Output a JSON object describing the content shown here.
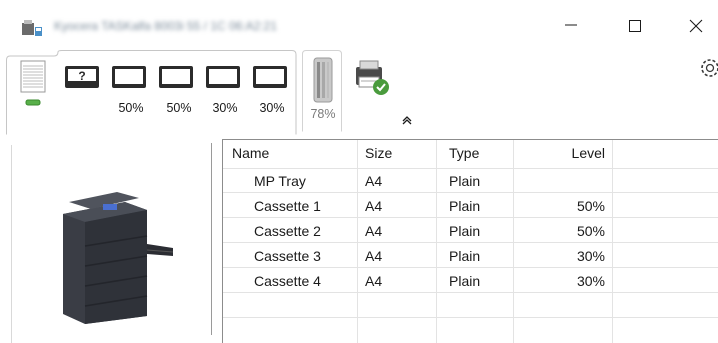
{
  "window": {
    "title": "Kyocera TASKalfa 8003i 55 / 1C 06:A2:21",
    "minimize_icon": "minimize-icon",
    "maximize_icon": "maximize-icon",
    "close_icon": "close-icon"
  },
  "toolbar": {
    "paper_icon": "paper-stack-icon",
    "trays": [
      {
        "icon": "unknown-tray-icon",
        "level": ""
      },
      {
        "icon": "tray-icon",
        "level": "50%"
      },
      {
        "icon": "tray-icon",
        "level": "50%"
      },
      {
        "icon": "tray-icon",
        "level": "30%"
      },
      {
        "icon": "tray-icon",
        "level": "30%"
      }
    ],
    "toner": {
      "icon": "toner-icon",
      "level": "78%"
    },
    "status_icon": "printer-ready-icon",
    "collapse_icon": "collapse-up-icon",
    "settings_icon": "gear-icon"
  },
  "table": {
    "columns": [
      "Name",
      "Size",
      "Type",
      "Level"
    ],
    "rows": [
      {
        "name": "MP Tray",
        "size": "A4",
        "type": "Plain",
        "level": ""
      },
      {
        "name": "Cassette 1",
        "size": "A4",
        "type": "Plain",
        "level": "50%"
      },
      {
        "name": "Cassette 2",
        "size": "A4",
        "type": "Plain",
        "level": "50%"
      },
      {
        "name": "Cassette 3",
        "size": "A4",
        "type": "Plain",
        "level": "30%"
      },
      {
        "name": "Cassette 4",
        "size": "A4",
        "type": "Plain",
        "level": "30%"
      }
    ]
  },
  "colors": {
    "accent": "#4a9b3d",
    "tray_dark": "#2b2b2b",
    "toner_gray": "#8a8a8a"
  }
}
